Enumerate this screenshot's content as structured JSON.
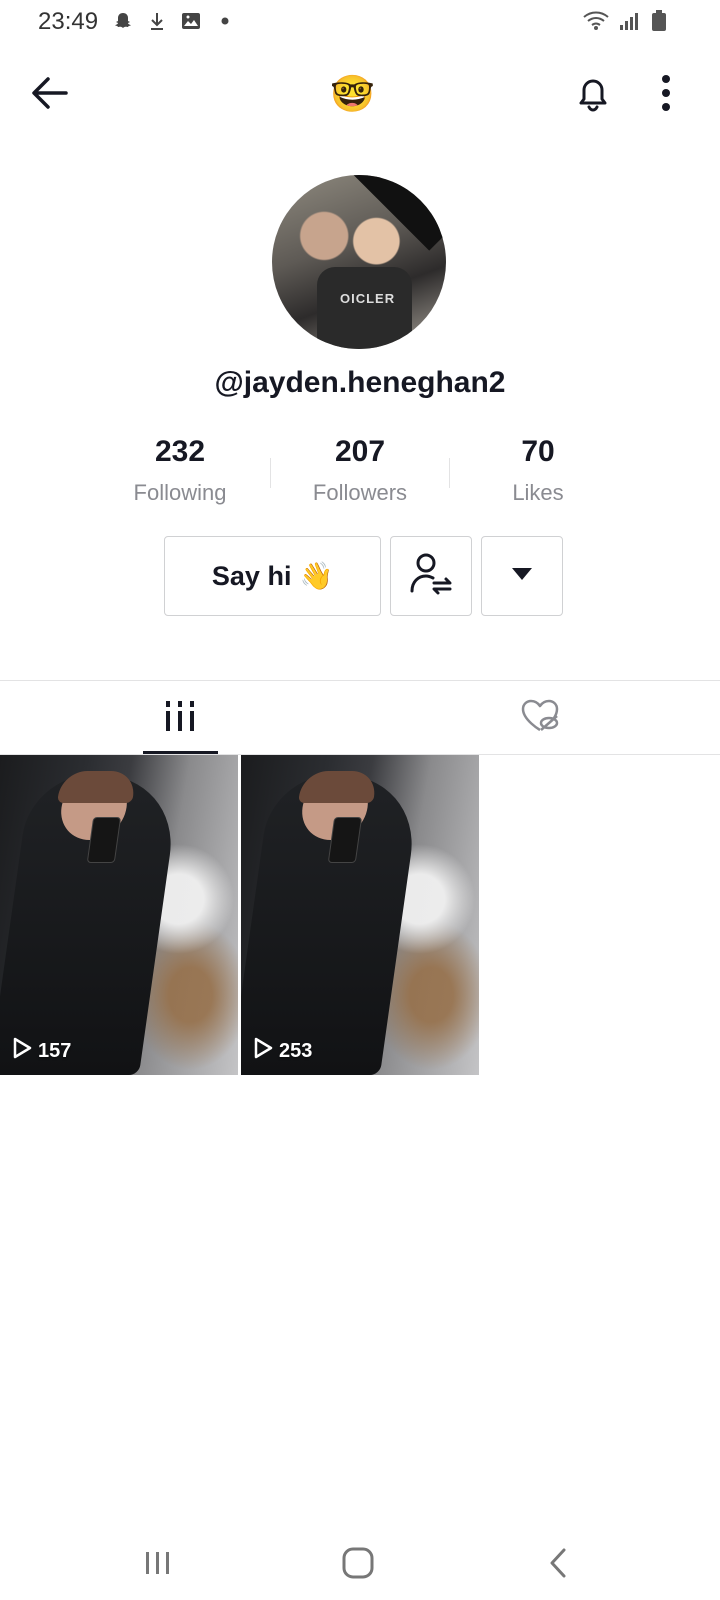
{
  "status_bar": {
    "time": "23:49",
    "left_icons": [
      "snapchat-icon",
      "download-icon",
      "gallery-icon",
      "dot-icon"
    ],
    "right_icons": [
      "wifi-icon",
      "signal-icon",
      "battery-icon"
    ]
  },
  "header": {
    "emoji": "🤓"
  },
  "profile": {
    "username": "@jayden.heneghan2",
    "avatar_shirt_text": "OICLER"
  },
  "stats": {
    "following": {
      "value": "232",
      "label": "Following"
    },
    "followers": {
      "value": "207",
      "label": "Followers"
    },
    "likes": {
      "value": "70",
      "label": "Likes"
    }
  },
  "actions": {
    "say_hi_label": "Say hi",
    "say_hi_emoji": "👋"
  },
  "tabs": {
    "active": "videos",
    "items": [
      {
        "name": "videos",
        "icon": "grid-icon"
      },
      {
        "name": "liked",
        "icon": "hidden-liked-icon"
      }
    ]
  },
  "videos": [
    {
      "views": "157"
    },
    {
      "views": "253"
    }
  ],
  "colors": {
    "text_primary": "#161823",
    "text_secondary": "#8a8b91",
    "border": "#d0d1d3"
  }
}
